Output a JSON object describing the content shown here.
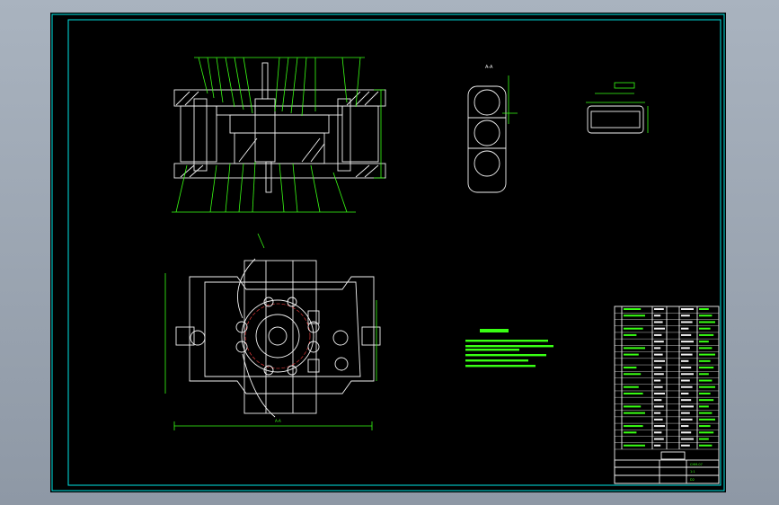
{
  "sheet": {
    "left_view_label": "A-A",
    "section_label": "A-A"
  },
  "title_block": {
    "drawing_no": "CHM-07",
    "scale": "1:1",
    "material": "D2"
  },
  "colors": {
    "border": "#00e6e6",
    "geometry": "#f2f2f2",
    "annotation": "#39ff14",
    "hidden": "#ff4040"
  }
}
